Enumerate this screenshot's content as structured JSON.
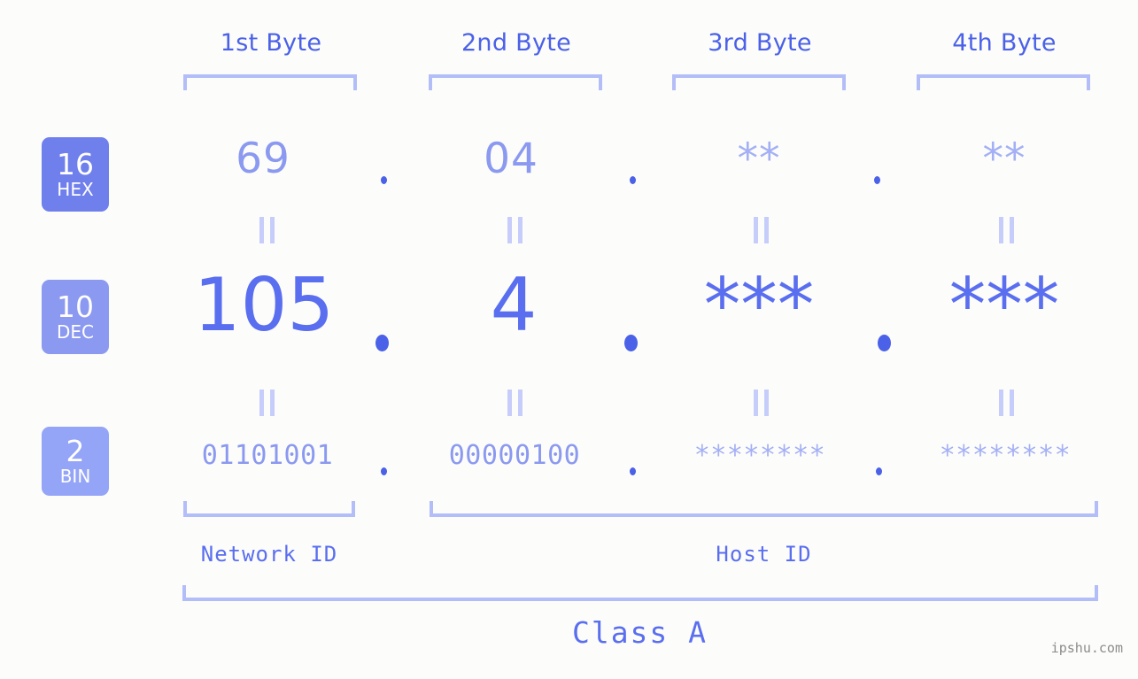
{
  "meta": {
    "background_color": "#fcfdfa",
    "accent_color": "#5a6ef0",
    "muted_accent_color": "#8b99f0",
    "bracket_color": "#b3bdf8",
    "watermark": "ipshu.com"
  },
  "byte_headers": [
    {
      "label": "1st Byte"
    },
    {
      "label": "2nd Byte"
    },
    {
      "label": "3rd Byte"
    },
    {
      "label": "4th Byte"
    }
  ],
  "bases": [
    {
      "number": "16",
      "name": "HEX",
      "color": "#6f7fec"
    },
    {
      "number": "10",
      "name": "DEC",
      "color": "#8b99f0"
    },
    {
      "number": "2",
      "name": "BIN",
      "color": "#94a4f7"
    }
  ],
  "rows": {
    "hex": {
      "values": [
        "69",
        "04",
        "**",
        "**"
      ]
    },
    "dec": {
      "values": [
        "105",
        "4",
        "***",
        "***"
      ]
    },
    "bin": {
      "values": [
        "01101001",
        "00000100",
        "********",
        "********"
      ]
    }
  },
  "separators": {
    "hex": [
      ".",
      ".",
      "."
    ],
    "dec": [
      ".",
      ".",
      "."
    ],
    "bin": [
      ".",
      ".",
      "."
    ]
  },
  "equals_marker": "=",
  "id_sections": [
    {
      "label": "Network ID"
    },
    {
      "label": "Host ID"
    }
  ],
  "class": {
    "label": "Class A"
  }
}
